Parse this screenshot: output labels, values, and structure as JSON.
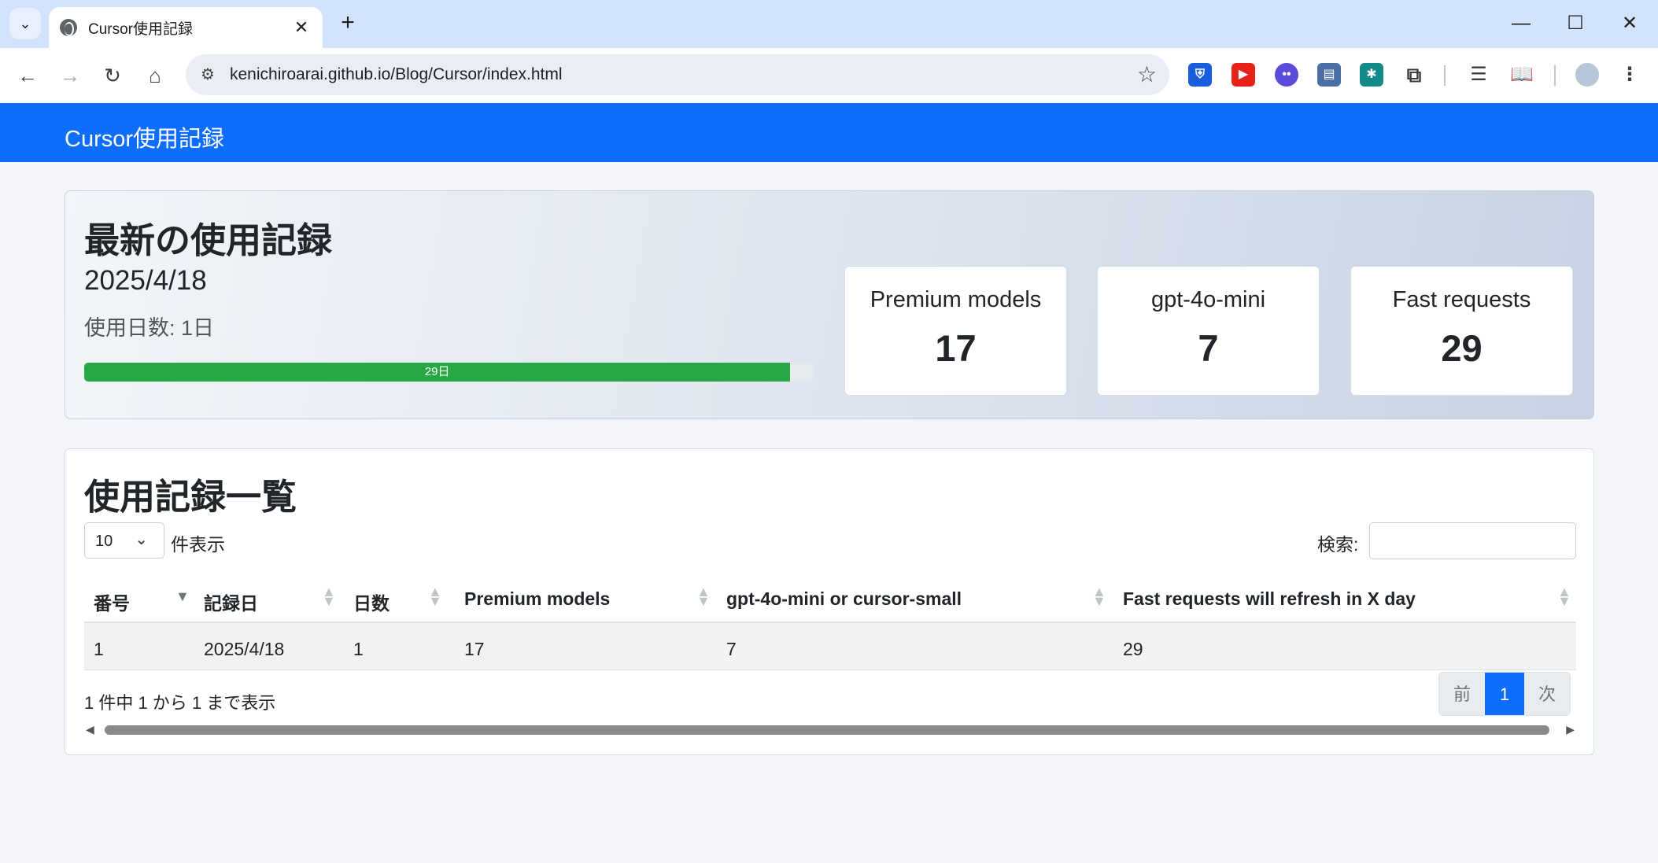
{
  "browser": {
    "tab_title": "Cursor使用記録",
    "url": "kenichiroarai.github.io/Blog/Cursor/index.html",
    "icons": {
      "tab_menu": "chevron-down-icon",
      "favicon": "globe-icon",
      "tab_close": "close-icon",
      "new_tab": "plus-icon",
      "minimize": "minimize-icon",
      "maximize": "maximize-icon",
      "close": "close-icon",
      "back": "back-arrow-icon",
      "forward": "forward-arrow-icon",
      "reload": "reload-icon",
      "home": "home-icon",
      "site_info": "tune-icon",
      "bookmark": "star-icon",
      "extensions": [
        "bitwarden-icon",
        "youtube-icon",
        "extension-face-icon",
        "extension-doc-icon",
        "extension-green-icon",
        "puzzle-icon"
      ],
      "reading_list": "reading-list-icon",
      "reader_mode": "book-icon",
      "profile": "avatar",
      "menu": "kebab-menu-icon"
    }
  },
  "navbar": {
    "brand": "Cursor使用記録",
    "color": "#0d6efd"
  },
  "latest": {
    "title": "最新の使用記録",
    "date": "2025/4/18",
    "days_label": "使用日数: 1日",
    "progress": {
      "label": "29日",
      "percent": 96.7,
      "color": "#28a745"
    },
    "stats": [
      {
        "label": "Premium models",
        "value": "17"
      },
      {
        "label": "gpt-4o-mini",
        "value": "7"
      },
      {
        "label": "Fast requests",
        "value": "29"
      }
    ]
  },
  "history": {
    "title": "使用記録一覧",
    "length_value": "10",
    "length_label": "件表示",
    "search_label": "検索:",
    "search_value": "",
    "columns": [
      "番号",
      "記録日",
      "日数",
      "Premium models",
      "gpt-4o-mini or cursor-small",
      "Fast requests will refresh in X day"
    ],
    "rows": [
      [
        "1",
        "2025/4/18",
        "1",
        "17",
        "7",
        "29"
      ]
    ],
    "info": "1 件中 1 から 1 まで表示",
    "pager": {
      "prev": "前",
      "page": "1",
      "next": "次"
    }
  }
}
